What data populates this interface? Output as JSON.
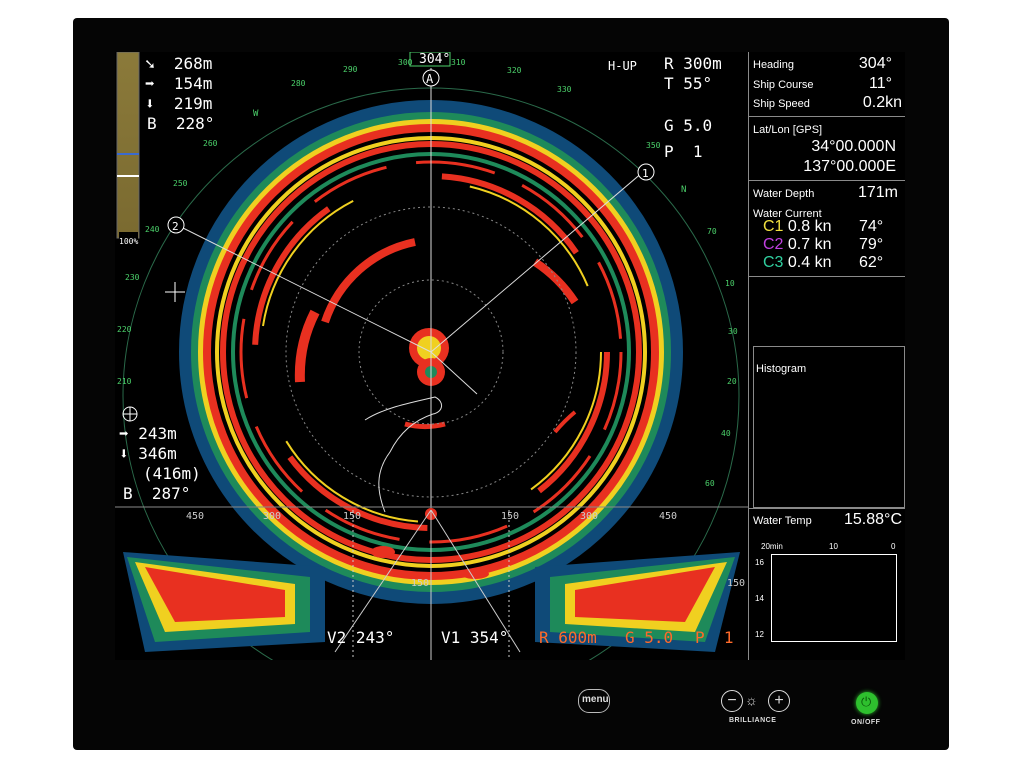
{
  "sonar": {
    "mode": "H-UP",
    "heading_marker": "304°",
    "marker_a": "A",
    "range": "R 300m",
    "tilt": "T 55°",
    "gain": "G 5.0",
    "preset": "P  1",
    "cursor_info": {
      "arrow1": "268m",
      "arrow2": "154m",
      "arrow3": "219m",
      "bearing": "B  228°"
    },
    "target_info": {
      "arrow1": "243m",
      "arrow2": "346m",
      "slant": "(416m)",
      "bearing": "B  287°"
    },
    "gain_bar_label": "100%",
    "markers": [
      "1",
      "2"
    ],
    "north": "N",
    "west": "W",
    "bearing_ticks": [
      "290",
      "300",
      "310",
      "320",
      "330",
      "350",
      "70",
      "30",
      "40",
      "60",
      "280",
      "260",
      "250",
      "240",
      "230",
      "220",
      "210",
      "10",
      "20"
    ]
  },
  "vertical": {
    "scale_top": [
      "450",
      "300",
      "150",
      "150",
      "300",
      "450"
    ],
    "scale_mid_left": "150",
    "scale_mid_right": "150",
    "v2": "V2 243°",
    "v1": "V1 354°",
    "range": "R 600m",
    "gain": "G 5.0",
    "preset": "P  1"
  },
  "panel": {
    "heading_label": "Heading",
    "heading_value": "304°",
    "course_label": "Ship Course",
    "course_value": "11°",
    "speed_label": "Ship Speed",
    "speed_value": "0.2kn",
    "latlon_label": "Lat/Lon [GPS]",
    "lat": "34°00.000N",
    "lon": "137°00.000E",
    "depth_label": "Water Depth",
    "depth_value": "171m",
    "current_label": "Water Current",
    "currents": [
      {
        "id": "C1",
        "speed": "0.8 kn",
        "dir": "74°",
        "color": "#f0e040"
      },
      {
        "id": "C2",
        "speed": "0.7 kn",
        "dir": "79°",
        "color": "#c040e0"
      },
      {
        "id": "C3",
        "speed": "0.4 kn",
        "dir": "62°",
        "color": "#30d0a0"
      }
    ],
    "histogram_label": "Histogram",
    "temp_label": "Water Temp",
    "temp_value": "15.88°C",
    "temp_chart": {
      "x_ticks": [
        "20min",
        "10",
        "0"
      ],
      "y_ticks": [
        "16",
        "14",
        "12"
      ]
    }
  },
  "controls": {
    "menu": "menu",
    "brilliance": "BRILLIANCE",
    "onoff": "ON/OFF",
    "power_color": "#2ec02e"
  }
}
